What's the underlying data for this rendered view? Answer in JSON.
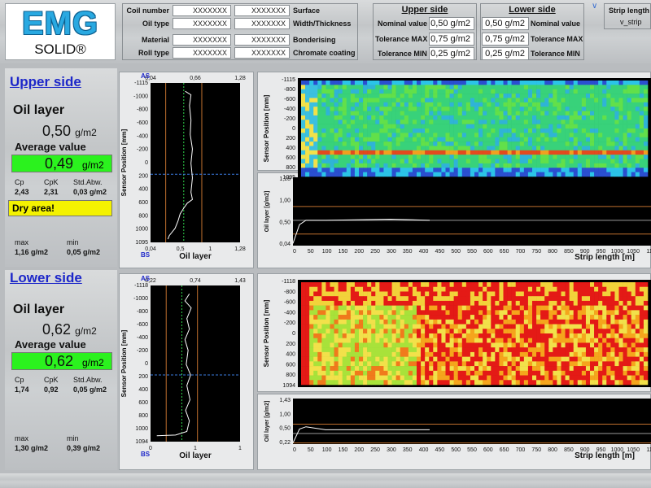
{
  "logo": {
    "brand": "EMG",
    "product": "SOLID®"
  },
  "header": {
    "coil": [
      {
        "label": "Coil number",
        "value": "XXXXXXX"
      },
      {
        "label": "Oil type",
        "value": "XXXXXXX"
      },
      {
        "label": "Material",
        "value": "XXXXXXX"
      },
      {
        "label": "Roll type",
        "value": "XXXXXXX"
      }
    ],
    "coil2": [
      {
        "label": "Surface",
        "value": "XXXXXXX"
      },
      {
        "label": "Width/Thickness",
        "value": "XXXXXXX"
      },
      {
        "label": "Bonderising",
        "value": "XXXXXXX"
      },
      {
        "label": "Chromate coating",
        "value": "XXXXXXX"
      }
    ],
    "upper": {
      "title": "Upper side",
      "nominal_label": "Nominal value",
      "nominal": "0,50 g/m2",
      "tmax_label": "Tolerance MAX",
      "tmax": "0,75 g/m2",
      "tmin_label": "Tolerance MIN",
      "tmin": "0,25 g/m2"
    },
    "lower": {
      "title": "Lower side",
      "nominal_label": "Nominal value",
      "nominal": "0,50 g/m2",
      "tmax_label": "Tolerance MAX",
      "tmax": "0,75 g/m2",
      "tmin_label": "Tolerance MIN",
      "tmin": "0,25 g/m2"
    },
    "strip": {
      "label": "Strip length",
      "value": "v_strip"
    }
  },
  "upper_side": {
    "title": "Upper side",
    "layer_label": "Oil layer",
    "layer_value": "0,50",
    "unit": "g/m2",
    "avg_label": "Average value",
    "avg_value": "0,49",
    "cp_label": "Cp",
    "cp": "2,43",
    "cpk_label": "CpK",
    "cpk": "2,31",
    "std_label": "Std.Abw.",
    "std": "0,03 g/m2",
    "warning": "Dry area!",
    "max_label": "max",
    "max": "1,16 g/m2",
    "min_label": "min",
    "min": "0,05 g/m2"
  },
  "lower_side": {
    "title": "Lower side",
    "layer_label": "Oil layer",
    "layer_value": "0,62",
    "unit": "g/m2",
    "avg_label": "Average value",
    "avg_value": "0,62",
    "cp_label": "Cp",
    "cp": "1,74",
    "cpk_label": "CpK",
    "cpk": "0,92",
    "std_label": "Std.Abw.",
    "std": "0,05 g/m2",
    "max_label": "max",
    "max": "1,30 g/m2",
    "min_label": "min",
    "min": "0,39 g/m2"
  },
  "colors": {
    "accent_blue": "#1d27c9",
    "ok_green": "#2bf21e",
    "warn_yellow": "#f4f200",
    "logo_blue": "#29a9e1"
  },
  "chart_data": [
    {
      "type": "line",
      "side": "AS/BS",
      "corner_top": "AS",
      "corner_bottom": "BS",
      "xlabel": "Oil layer",
      "ylabel": "Sensor Position [mm]",
      "x_bottom_ticks": [
        "0,04",
        "0,5",
        "1",
        "1,28"
      ],
      "x_top_ticks": [
        "0,04",
        "0,66",
        "1,28"
      ],
      "y_ticks": [
        "-1115",
        "-1000",
        "-800",
        "-600",
        "-400",
        "-200",
        "0",
        "200",
        "400",
        "600",
        "800",
        "1000",
        "1095"
      ],
      "xlim": [
        0.04,
        1.28
      ],
      "ylim": [
        -1115,
        1095
      ],
      "profile": [
        [
          0.52,
          -1000
        ],
        [
          0.6,
          -950
        ],
        [
          0.58,
          -800
        ],
        [
          0.6,
          -600
        ],
        [
          0.59,
          -400
        ],
        [
          0.62,
          -200
        ],
        [
          0.6,
          0
        ],
        [
          0.62,
          200
        ],
        [
          0.6,
          400
        ],
        [
          0.62,
          500
        ],
        [
          0.55,
          550
        ],
        [
          0.5,
          620
        ],
        [
          0.45,
          700
        ],
        [
          0.42,
          800
        ],
        [
          0.38,
          900
        ],
        [
          0.34,
          950
        ],
        [
          0.3,
          1000
        ],
        [
          0.28,
          1050
        ]
      ]
    },
    {
      "type": "heatmap",
      "ylabel": "Sensor Position [mm]",
      "y_ticks": [
        "-1115",
        "-800",
        "-600",
        "-400",
        "-200",
        "0",
        "200",
        "400",
        "600",
        "800",
        "1095"
      ]
    },
    {
      "type": "line",
      "xlabel": "Strip length [m]",
      "ylabel": "Oil layer [g/m2]",
      "x_ticks": [
        "0",
        "50",
        "100",
        "150",
        "200",
        "250",
        "300",
        "350",
        "400",
        "450",
        "500",
        "550",
        "600",
        "650",
        "700",
        "750",
        "800",
        "850",
        "900",
        "950",
        "1000",
        "1050",
        "11"
      ],
      "y_ticks": [
        "1,28",
        "1,00",
        "0,50",
        "0,04"
      ],
      "ylim": [
        0.04,
        1.28
      ],
      "series": [
        {
          "values": [
            [
              0,
              0.08
            ],
            [
              20,
              0.42
            ],
            [
              40,
              0.5
            ],
            [
              100,
              0.5
            ],
            [
              300,
              0.52
            ],
            [
              420,
              0.5
            ]
          ]
        }
      ]
    },
    {
      "type": "line",
      "side": "AS/BS",
      "corner_top": "AS",
      "corner_bottom": "BS",
      "xlabel": "Oil layer",
      "ylabel": "Sensor Position [mm]",
      "x_bottom_ticks": [
        "0",
        "1",
        "1"
      ],
      "x_top_ticks": [
        "0,22",
        "0,74",
        "1,43"
      ],
      "y_ticks": [
        "-1118",
        "-1000",
        "-800",
        "-600",
        "-400",
        "-200",
        "0",
        "200",
        "400",
        "600",
        "800",
        "1000",
        "1094"
      ],
      "xlim": [
        0.0,
        1.43
      ],
      "ylim": [
        -1118,
        1094
      ],
      "profile": [
        [
          0.62,
          -1000
        ],
        [
          0.55,
          -900
        ],
        [
          0.65,
          -800
        ],
        [
          0.58,
          -650
        ],
        [
          0.62,
          -500
        ],
        [
          0.55,
          -350
        ],
        [
          0.6,
          -200
        ],
        [
          0.57,
          0
        ],
        [
          0.64,
          150
        ],
        [
          0.58,
          300
        ],
        [
          0.63,
          500
        ],
        [
          0.56,
          650
        ],
        [
          0.62,
          800
        ],
        [
          0.58,
          950
        ],
        [
          0.4,
          1000
        ],
        [
          0.1,
          1010
        ]
      ]
    },
    {
      "type": "heatmap",
      "ylabel": "Sensor Position [mm]",
      "y_ticks": [
        "-1118",
        "-800",
        "-600",
        "-400",
        "-200",
        "0",
        "200",
        "400",
        "600",
        "800",
        "1094"
      ]
    },
    {
      "type": "line",
      "xlabel": "Strip length [m]",
      "ylabel": "Oil layer [g/m2]",
      "x_ticks": [
        "0",
        "50",
        "100",
        "150",
        "200",
        "250",
        "300",
        "350",
        "400",
        "450",
        "500",
        "550",
        "600",
        "650",
        "700",
        "750",
        "800",
        "850",
        "900",
        "950",
        "1000",
        "1050",
        "11"
      ],
      "y_ticks": [
        "1,43",
        "1,00",
        "0,50",
        "0,22"
      ],
      "ylim": [
        0.22,
        1.43
      ],
      "series": [
        {
          "values": [
            [
              0,
              0.25
            ],
            [
              20,
              0.62
            ],
            [
              40,
              0.68
            ],
            [
              100,
              0.6
            ],
            [
              300,
              0.6
            ],
            [
              420,
              0.6
            ]
          ]
        }
      ]
    }
  ]
}
